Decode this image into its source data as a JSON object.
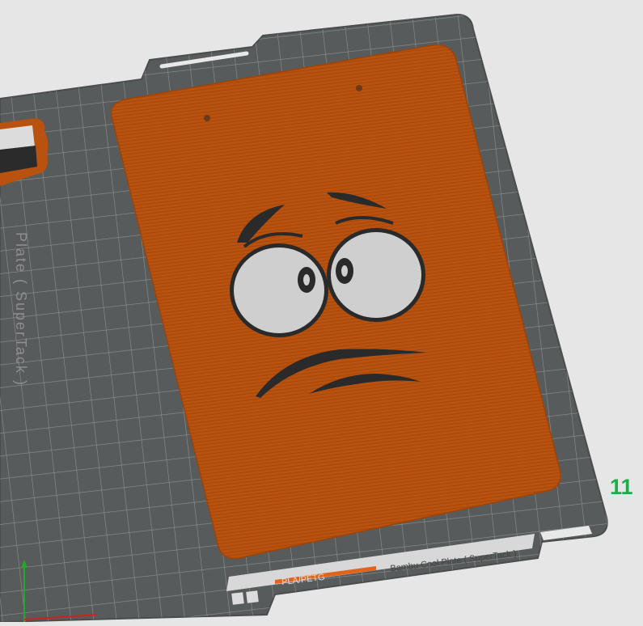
{
  "plate": {
    "name_vertical": "Plate ( SuperTack )",
    "name_label": "Bambu Cool Plate ( SuperTack )",
    "filament_label": "PLA/PETG",
    "plate_number": "11"
  },
  "colors": {
    "background": "#e6e6e6",
    "bed": "#585b5b",
    "grid_line": "#8d9090",
    "model": "#b8520e",
    "face_dark": "#2a2a2a",
    "eye_white": "#cfcfcf",
    "plate_number": "#1faa4b"
  },
  "icons": {
    "axis_indicator": "axis-icon",
    "model_object": "clipboard-model",
    "side_object": "small-tag-model"
  }
}
